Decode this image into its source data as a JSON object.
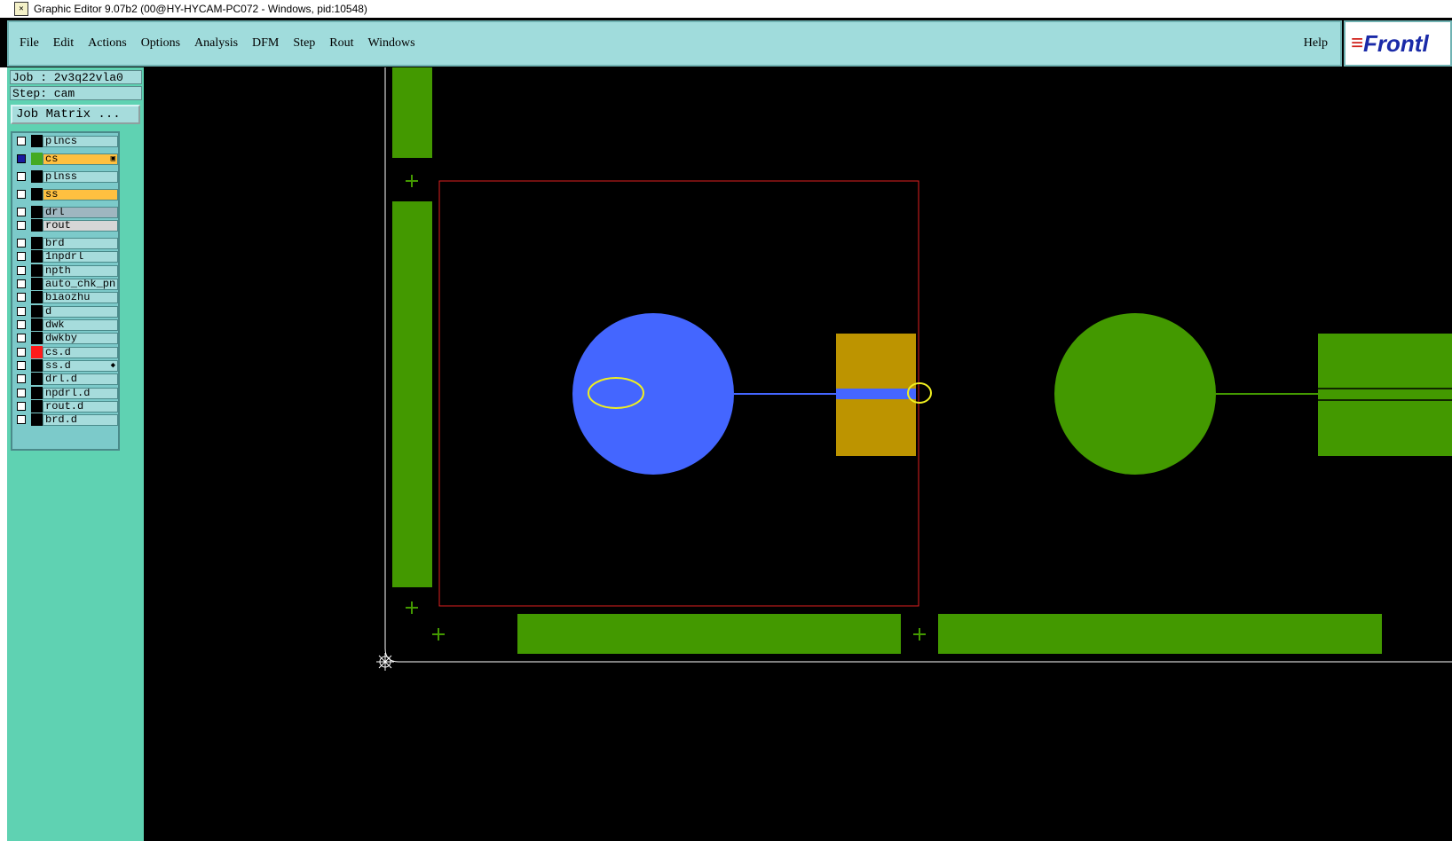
{
  "window": {
    "title": "Graphic Editor 9.07b2 (00@HY-HYCAM-PC072 - Windows, pid:10548)"
  },
  "menubar": {
    "items": [
      "File",
      "Edit",
      "Actions",
      "Options",
      "Analysis",
      "DFM",
      "Step",
      "Rout",
      "Windows"
    ],
    "help": "Help"
  },
  "logo": {
    "text": "Frontl",
    "mark": "≡"
  },
  "job": {
    "job_line": "Job : 2v3q22vla0",
    "step_line": "Step: cam",
    "matrix_button": "Job Matrix ..."
  },
  "layers": [
    {
      "name": "plncs",
      "color": "#a6dcdc"
    },
    {
      "name": "cs",
      "color": "#ffc040",
      "active": true,
      "swatch": "#44aa22",
      "marker": "▣"
    },
    {
      "name": "plnss",
      "color": "#a6dcdc"
    },
    {
      "name": "ss",
      "color": "#ffc040"
    },
    {
      "name": "drl",
      "color": "#9fb6c0"
    },
    {
      "name": "rout",
      "color": "#d6d6d6"
    },
    {
      "name": "brd",
      "color": "#a6dcdc"
    },
    {
      "name": "1npdrl",
      "color": "#a6dcdc"
    },
    {
      "name": "npth",
      "color": "#a6dcdc"
    },
    {
      "name": "auto_chk_pn",
      "color": "#a6dcdc"
    },
    {
      "name": "biaozhu",
      "color": "#a6dcdc"
    },
    {
      "name": "d",
      "color": "#a6dcdc"
    },
    {
      "name": "dwk",
      "color": "#a6dcdc"
    },
    {
      "name": "dwkby",
      "color": "#a6dcdc"
    },
    {
      "name": "cs.d",
      "color": "#a6dcdc",
      "swatch": "#ff1a1a"
    },
    {
      "name": "ss.d",
      "color": "#a6dcdc",
      "marker": "◆"
    },
    {
      "name": "drl.d",
      "color": "#a6dcdc"
    },
    {
      "name": "npdrl.d",
      "color": "#a6dcdc"
    },
    {
      "name": "rout.d",
      "color": "#a6dcdc"
    },
    {
      "name": "brd.d",
      "color": "#a6dcdc"
    }
  ],
  "colors": {
    "pad_green": "#439900",
    "selected_blue": "#4466ff",
    "smd_gold": "#bd9400",
    "frame_red": "#e02020",
    "highlight_yellow": "#f0f020",
    "panel_teal": "#5fd2b2",
    "menubar_bg": "#a0dcdc"
  },
  "icons": {
    "origin": "origin-compass-icon",
    "datum": "datum-cross-icon"
  }
}
